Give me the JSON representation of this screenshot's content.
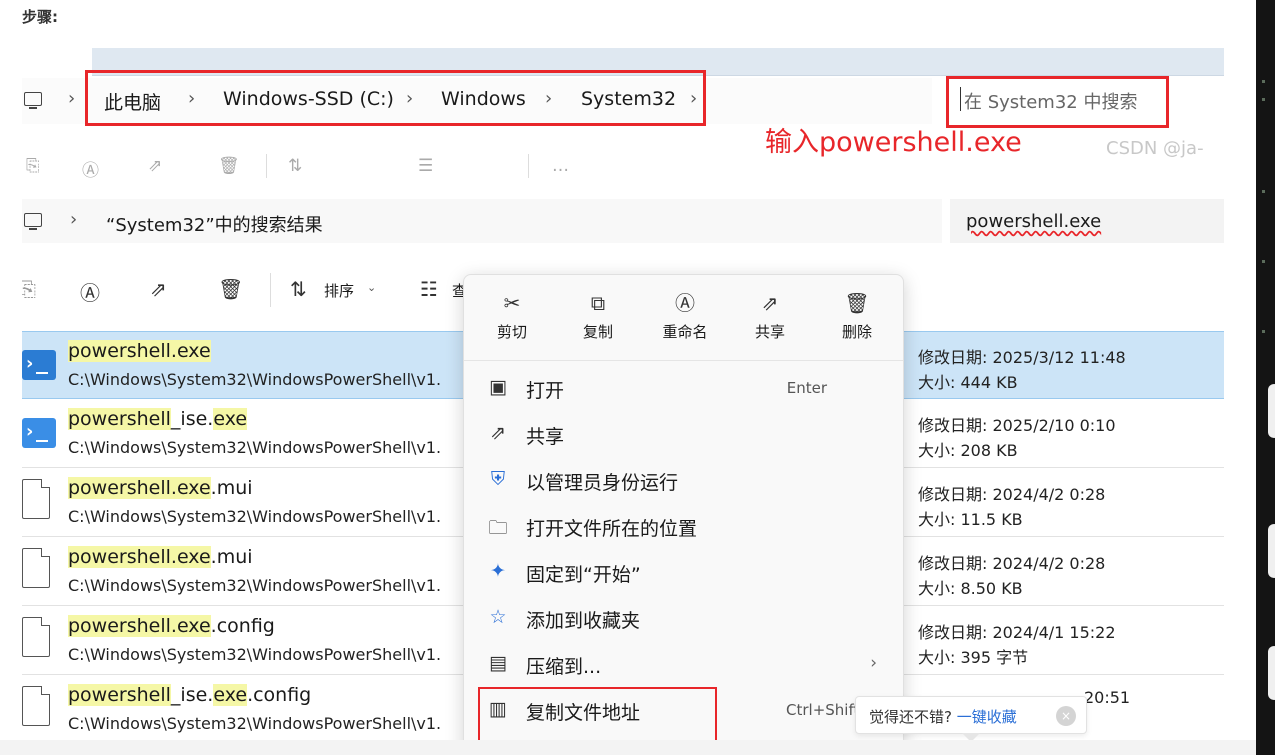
{
  "steps_label": "步骤:",
  "shot1": {
    "breadcrumb": [
      "此电脑",
      "Windows-SSD (C:)",
      "Windows",
      "System32"
    ],
    "search_placeholder": "在 System32 中搜索",
    "annotation": "输入powershell.exe",
    "watermark": "CSDN @ja-"
  },
  "shot2": {
    "breadcrumb": "“System32”中的搜索结果",
    "search_value": "powershell.exe",
    "toolbar": {
      "sort_label": "排序",
      "view_label": "查"
    },
    "files": [
      {
        "name_hl": "powershell.exe",
        "name_mid": "",
        "name_hl2": "",
        "name_rest": "",
        "path": "C:\\Windows\\System32\\WindowsPowerShell\\v1.",
        "modified": "修改日期: 2025/3/12 11:48",
        "size": "大小: 444 KB",
        "icon": "powershell-icon",
        "selected": true
      },
      {
        "name_hl": "powershell",
        "name_mid": "_ise.",
        "name_hl2": "exe",
        "name_rest": "",
        "path": "C:\\Windows\\System32\\WindowsPowerShell\\v1.",
        "modified": "修改日期: 2025/2/10 0:10",
        "size": "大小: 208 KB",
        "icon": "powershell-ise-icon"
      },
      {
        "name_hl": "powershell.exe",
        "name_mid": "",
        "name_hl2": "",
        "name_rest": ".mui",
        "path": "C:\\Windows\\System32\\WindowsPowerShell\\v1.",
        "modified": "修改日期: 2024/4/2 0:28",
        "size": "大小: 11.5 KB",
        "icon": "file-icon"
      },
      {
        "name_hl": "powershell.exe",
        "name_mid": "",
        "name_hl2": "",
        "name_rest": ".mui",
        "path": "C:\\Windows\\System32\\WindowsPowerShell\\v1.",
        "modified": "修改日期: 2024/4/2 0:28",
        "size": "大小: 8.50 KB",
        "icon": "file-icon"
      },
      {
        "name_hl": "powershell.exe",
        "name_mid": "",
        "name_hl2": "",
        "name_rest": ".config",
        "path": "C:\\Windows\\System32\\WindowsPowerShell\\v1.",
        "modified": "修改日期: 2024/4/1 15:22",
        "size": "大小: 395 字节",
        "icon": "file-icon"
      },
      {
        "name_hl": "powershell",
        "name_mid": "_ise.",
        "name_hl2": "exe",
        "name_rest": ".config",
        "path": "C:\\Windows\\System32\\WindowsPowerShell\\v1.",
        "modified": "",
        "size": "",
        "icon": "file-icon",
        "meta_fragment": "20:51"
      }
    ]
  },
  "context_menu": {
    "top_actions": [
      {
        "label": "剪切",
        "icon": "scissors-icon"
      },
      {
        "label": "复制",
        "icon": "copy-icon"
      },
      {
        "label": "重命名",
        "icon": "rename-icon"
      },
      {
        "label": "共享",
        "icon": "share-icon"
      },
      {
        "label": "删除",
        "icon": "trash-icon"
      }
    ],
    "items": [
      {
        "label": "打开",
        "shortcut": "Enter",
        "icon": "open-icon"
      },
      {
        "label": "共享",
        "shortcut": "",
        "icon": "share-icon"
      },
      {
        "label": "以管理员身份运行",
        "shortcut": "",
        "icon": "admin-shield-icon"
      },
      {
        "label": "打开文件所在的位置",
        "shortcut": "",
        "icon": "folder-icon"
      },
      {
        "label": "固定到“开始”",
        "shortcut": "",
        "icon": "pin-icon"
      },
      {
        "label": "添加到收藏夹",
        "shortcut": "",
        "icon": "star-icon"
      },
      {
        "label": "压缩到...",
        "shortcut": "",
        "icon": "zip-icon",
        "submenu": true
      },
      {
        "label": "复制文件地址",
        "shortcut": "Ctrl+Shift",
        "icon": "copy-path-icon"
      }
    ]
  },
  "tooltip": {
    "text": "觉得还不错?",
    "link": "一键收藏",
    "close": "×"
  },
  "colors": {
    "annotation_red": "#e8262a",
    "selection_blue": "#cce4f7",
    "highlight_yellow": "#f5f7a6",
    "link_blue": "#2b6fd6"
  }
}
